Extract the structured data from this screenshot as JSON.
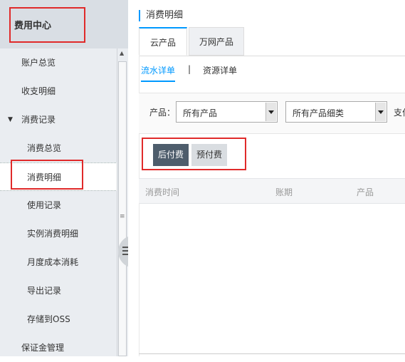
{
  "sidebar": {
    "title": "费用中心",
    "items": [
      {
        "label": "账户总览",
        "level": 1
      },
      {
        "label": "收支明细",
        "level": 1
      },
      {
        "label": "消费记录",
        "level": 1,
        "expanded": true
      },
      {
        "label": "消费总览",
        "level": 2
      },
      {
        "label": "消费明细",
        "level": 2,
        "active": true
      },
      {
        "label": "使用记录",
        "level": 2
      },
      {
        "label": "实例消费明细",
        "level": 2
      },
      {
        "label": "月度成本消耗",
        "level": 2
      },
      {
        "label": "导出记录",
        "level": 2
      },
      {
        "label": "存储到OSS",
        "level": 2
      },
      {
        "label": "保证金管理",
        "level": 1
      }
    ]
  },
  "main": {
    "title": "消费明细",
    "tabs": [
      "云产品",
      "万网产品"
    ],
    "subtabs": {
      "flow": "流水详单",
      "separator": "|",
      "resource": "资源详单"
    },
    "filter": {
      "product_label": "产品：",
      "product_value": "所有产品",
      "category_value": "所有产品细类",
      "truncated_label": "支付"
    },
    "pay_buttons": {
      "postpaid": "后付费",
      "prepaid": "预付费"
    },
    "table_headers": [
      "消费时间",
      "账期",
      "产品"
    ]
  },
  "colors": {
    "accent": "#0099ff",
    "highlight_box": "#e02a2a",
    "sidebar_bg": "#eaedf1",
    "active_button": "#4e5d6c"
  }
}
